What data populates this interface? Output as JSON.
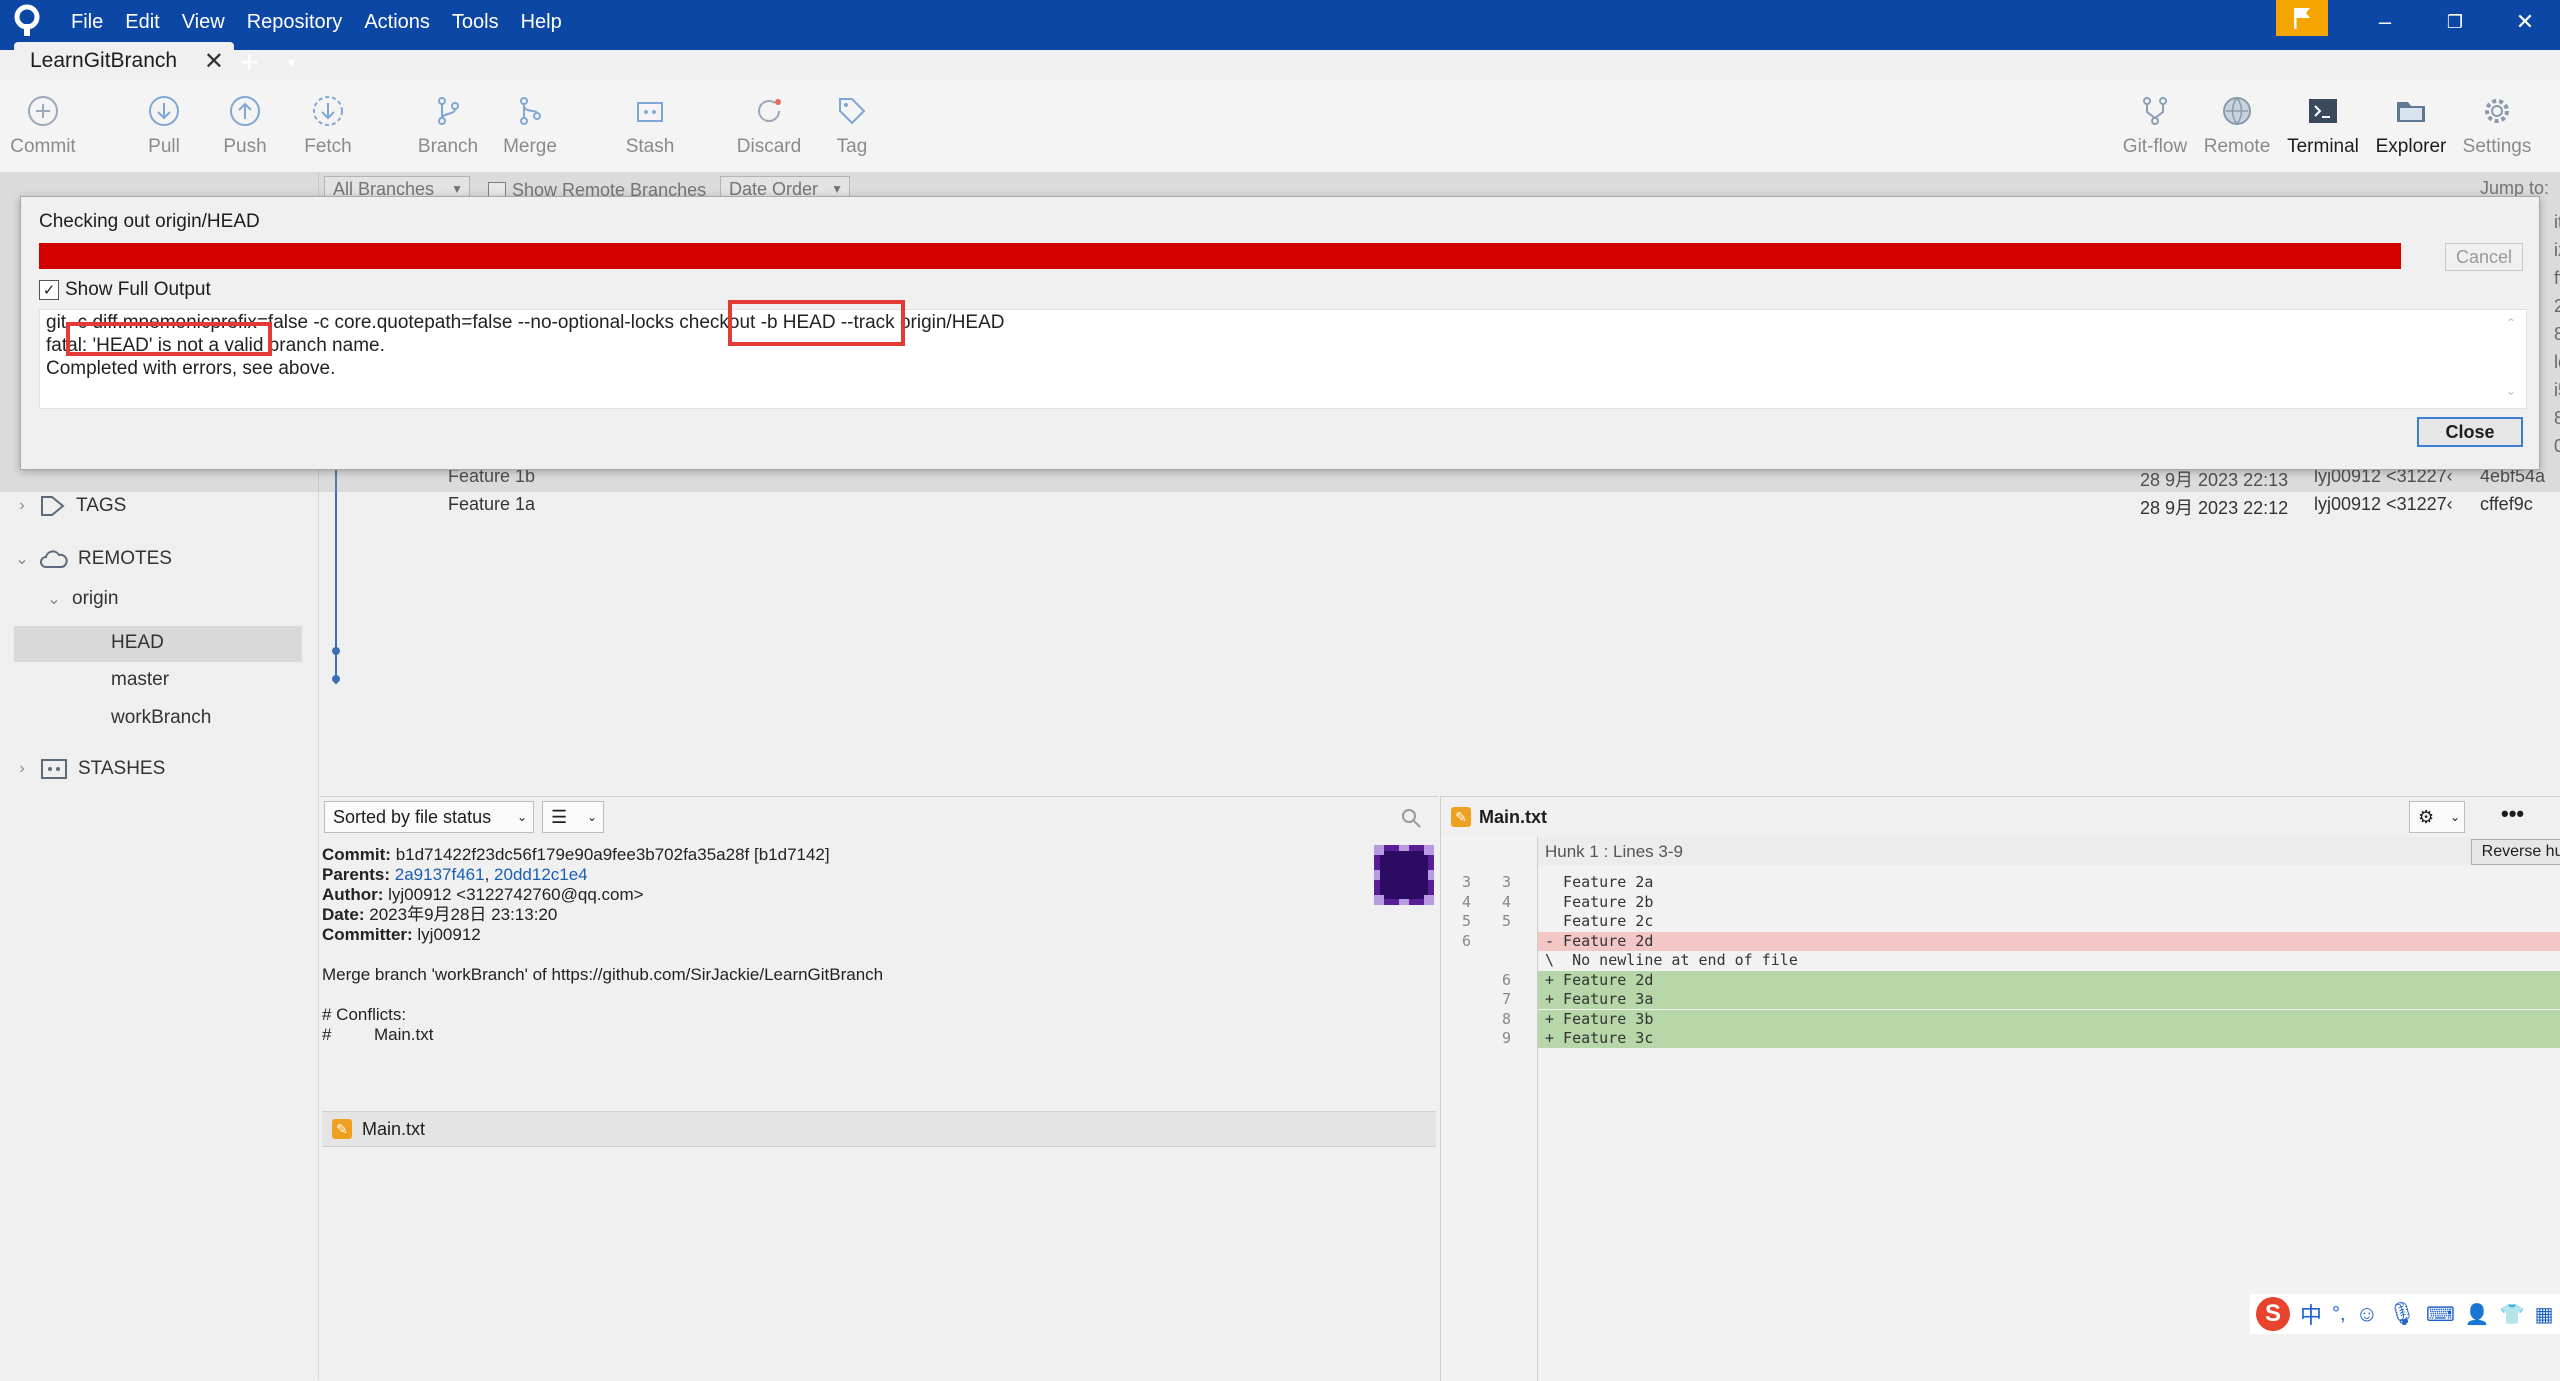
{
  "window": {
    "menu": [
      "File",
      "Edit",
      "View",
      "Repository",
      "Actions",
      "Tools",
      "Help"
    ],
    "tab_title": "LearnGitBranch",
    "tab_close": "✕",
    "tab_add": "+",
    "tab_menu": "▾",
    "win_min": "–",
    "win_restore": "❐",
    "win_close": "✕"
  },
  "toolbar": {
    "commit": "Commit",
    "pull": "Pull",
    "push": "Push",
    "fetch": "Fetch",
    "branch": "Branch",
    "merge": "Merge",
    "stash": "Stash",
    "discard": "Discard",
    "tag": "Tag",
    "gitflow": "Git-flow",
    "remote": "Remote",
    "terminal": "Terminal",
    "explorer": "Explorer",
    "settings": "Settings"
  },
  "filters": {
    "branches": "All Branches",
    "show_remote": "Show Remote Branches",
    "order": "Date Order",
    "jump_to": "Jump to:"
  },
  "sidebar": {
    "tags": "TAGS",
    "remotes": "REMOTES",
    "origin": "origin",
    "remote_branches": [
      "HEAD",
      "master",
      "workBranch"
    ],
    "stashes": "STASHES"
  },
  "commits": [
    {
      "message": "Feature 1b",
      "date": "28 9月 2023 22:13",
      "author": "lyj00912 <31227‹",
      "hash": "4ebf54a"
    },
    {
      "message": "Feature 1a",
      "date": "28 9月 2023 22:12",
      "author": "lyj00912 <31227‹",
      "hash": "cffef9c"
    }
  ],
  "right_edge_fragments": [
    "it",
    "iz",
    "ff",
    "2e",
    "8",
    "lc",
    "i5",
    "8",
    "0a"
  ],
  "dialog": {
    "title": "Checking out origin/HEAD",
    "cancel": "Cancel",
    "show_full_output": "Show Full Output",
    "output": [
      "git -c diff.mnemonicprefix=false -c core.quotepath=false --no-optional-locks checkout -b HEAD --track origin/HEAD",
      "fatal: 'HEAD' is not a valid branch name.",
      "Completed with errors, see above."
    ],
    "close": "Close"
  },
  "details": {
    "sort": "Sorted by file status",
    "commit_label": "Commit:",
    "commit_value": "b1d71422f23dc56f179e90a9fee3b702fa35a28f [b1d7142]",
    "parents_label": "Parents:",
    "parent1": "2a9137f461",
    "parent_sep": ", ",
    "parent2": "20dd12c1e4",
    "author_label": "Author:",
    "author_value": "lyj00912 <3122742760@qq.com>",
    "date_label": "Date:",
    "date_value": "2023年9月28日 23:13:20",
    "committer_label": "Committer:",
    "committer_value": "lyj00912",
    "message": "Merge branch 'workBranch' of https://github.com/SirJackie/LearnGitBranch",
    "conflicts_title": "# Conflicts:",
    "conflicts_file": "#         Main.txt",
    "file": "Main.txt"
  },
  "diff": {
    "file": "Main.txt",
    "hunk": "Hunk 1 : Lines 3-9",
    "reverse_hunk": "Reverse hunk",
    "lines": [
      {
        "old": "3",
        "new": "3",
        "text": "  Feature 2a",
        "kind": "ctx"
      },
      {
        "old": "4",
        "new": "4",
        "text": "  Feature 2b",
        "kind": "ctx"
      },
      {
        "old": "5",
        "new": "5",
        "text": "  Feature 2c",
        "kind": "ctx"
      },
      {
        "old": "6",
        "new": "",
        "text": "- Feature 2d",
        "kind": "del"
      },
      {
        "old": "",
        "new": "",
        "text": "\\  No newline at end of file",
        "kind": "ctx"
      },
      {
        "old": "",
        "new": "6",
        "text": "+ Feature 2d",
        "kind": "add"
      },
      {
        "old": "",
        "new": "7",
        "text": "+ Feature 3a",
        "kind": "add"
      },
      {
        "old": "",
        "new": "8",
        "text": "+ Feature 3b",
        "kind": "add"
      },
      {
        "old": "",
        "new": "9",
        "text": "+ Feature 3c",
        "kind": "add"
      }
    ]
  },
  "ime": {
    "lang": "中",
    "punct": "°,"
  },
  "colors": {
    "titlebar": "#0d47a6",
    "flag": "#f5a500",
    "progress_error": "#d40000",
    "highlight_box": "#e53935",
    "link": "#1a5fb4",
    "diff_add": "#b7d7a8",
    "diff_del": "#f4c7c7"
  }
}
